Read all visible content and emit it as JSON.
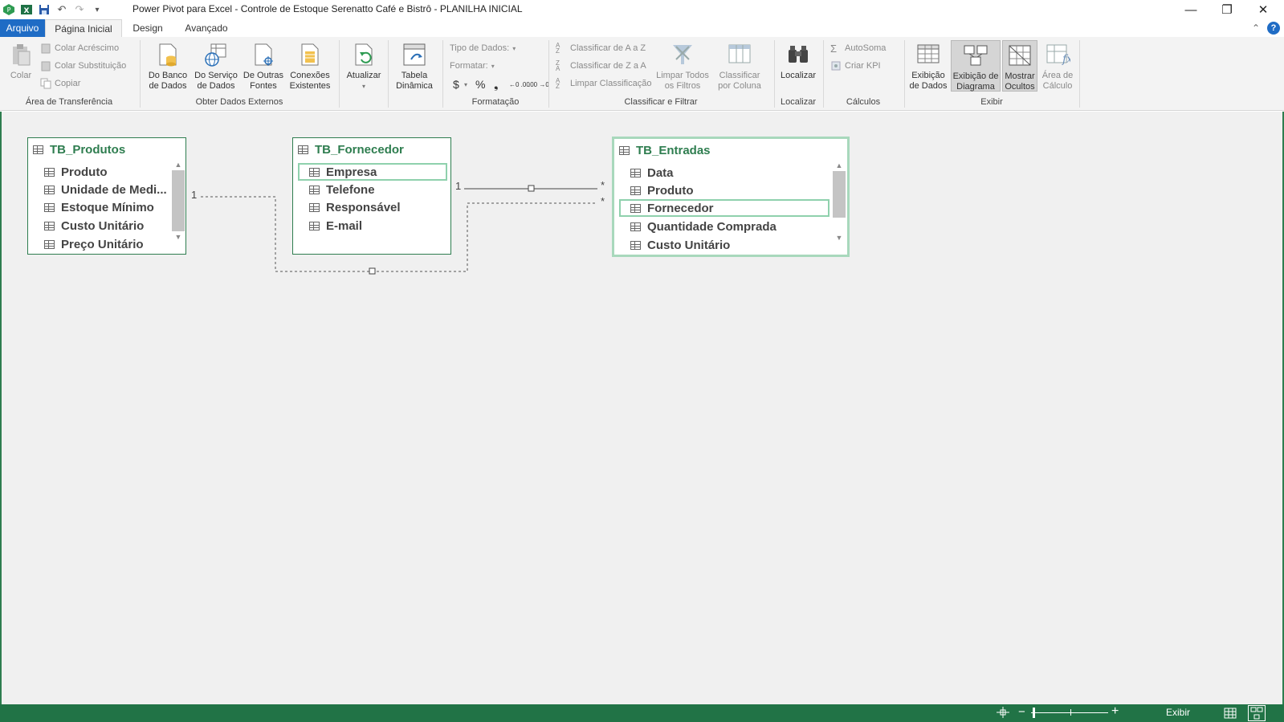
{
  "window": {
    "title": "Power Pivot para Excel - Controle de Estoque Serenatto Café e Bistrô - PLANILHA INICIAL",
    "minimize": "—",
    "restore": "❐",
    "close": "✕"
  },
  "qat": {
    "undo": "↶",
    "redo": "↷",
    "customize": "▾"
  },
  "tabs": {
    "file": "Arquivo",
    "home": "Página Inicial",
    "design": "Design",
    "advanced": "Avançado",
    "collapse": "⌃",
    "help": "?"
  },
  "ribbon": {
    "clipboard": {
      "label": "Área de Transferência",
      "paste": "Colar",
      "paste_append": "Colar Acréscimo",
      "paste_replace": "Colar Substituição",
      "copy": "Copiar"
    },
    "external": {
      "label": "Obter Dados Externos",
      "from_db_1": "Do Banco",
      "from_db_2": "de Dados",
      "from_service_1": "Do Serviço",
      "from_service_2": "de Dados",
      "from_other_1": "De Outras",
      "from_other_2": "Fontes",
      "existing_1": "Conexões",
      "existing_2": "Existentes"
    },
    "refresh": {
      "label": "Atualizar"
    },
    "pivot": {
      "label_1": "Tabela",
      "label_2": "Dinâmica"
    },
    "formatting": {
      "label": "Formatação",
      "data_type": "Tipo de Dados:",
      "format": "Formatar:",
      "currency": "$",
      "percent": "%",
      "comma": "❟",
      "inc_dec": "←0 .00",
      "dec_dec": ".00 →0"
    },
    "sort": {
      "label": "Classificar e Filtrar",
      "az": "Classificar de A a Z",
      "za": "Classificar de Z a A",
      "clear_sort": "Limpar Classificação",
      "clear_filters_1": "Limpar Todos",
      "clear_filters_2": "os Filtros",
      "sort_col_1": "Classificar",
      "sort_col_2": "por Coluna"
    },
    "find": {
      "label": "Localizar",
      "btn": "Localizar"
    },
    "calc": {
      "label": "Cálculos",
      "autosum": "AutoSoma",
      "kpi": "Criar KPI"
    },
    "view": {
      "label": "Exibir",
      "data_view_1": "Exibição",
      "data_view_2": "de Dados",
      "diagram_view_1": "Exibição de",
      "diagram_view_2": "Diagrama",
      "show_hidden_1": "Mostrar",
      "show_hidden_2": "Ocultos",
      "calc_area_1": "Área de",
      "calc_area_2": "Cálculo"
    }
  },
  "diagram": {
    "tables": [
      {
        "name": "TB_Produtos",
        "fields": [
          "Produto",
          "Unidade de Medi...",
          "Estoque Mínimo",
          "Custo Unitário",
          "Preço Unitário"
        ]
      },
      {
        "name": "TB_Fornecedor",
        "fields": [
          "Empresa",
          "Telefone",
          "Responsável",
          "E-mail"
        ]
      },
      {
        "name": "TB_Entradas",
        "fields": [
          "Data",
          "Produto",
          "Fornecedor",
          "Quantidade Comprada",
          "Custo Unitário"
        ]
      }
    ],
    "relationships": {
      "one_produtos": "1",
      "one_fornecedor": "1",
      "many_a": "*",
      "many_b": "*"
    }
  },
  "status": {
    "exibir": "Exibir",
    "zoom_minus": "−",
    "zoom_plus": "+"
  },
  "colors": {
    "accent": "#2e7d4f",
    "file_tab": "#1f6cc5",
    "statusbar": "#217346",
    "selection": "#a8d8bc"
  }
}
